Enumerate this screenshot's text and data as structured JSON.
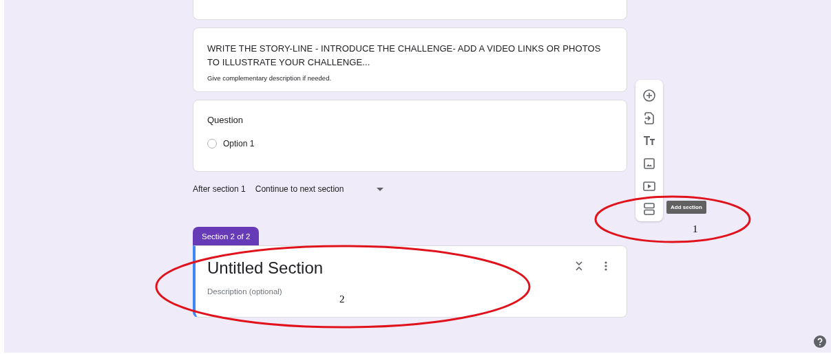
{
  "description_card": {
    "title": "WRITE THE STORY-LINE - INTRODUCE THE CHALLENGE- ADD A VIDEO LINKS OR PHOTOS TO ILLUSTRATE YOUR CHALLENGE...",
    "description": "Give complementary description if needed."
  },
  "question": {
    "title": "Question",
    "options": [
      {
        "label": "Option 1",
        "selected": false
      }
    ]
  },
  "after_section": {
    "label": "After section 1",
    "value": "Continue to next section"
  },
  "section": {
    "tab": "Section 2 of 2",
    "title": "Untitled Section",
    "placeholder": "Description (optional)"
  },
  "toolbar": [
    {
      "kind": "add-question"
    },
    {
      "kind": "import"
    },
    {
      "kind": "title"
    },
    {
      "kind": "image"
    },
    {
      "kind": "video"
    },
    {
      "kind": "section"
    }
  ],
  "tooltip": "Add section",
  "annotations": [
    {
      "label": "1"
    },
    {
      "label": "2"
    }
  ]
}
